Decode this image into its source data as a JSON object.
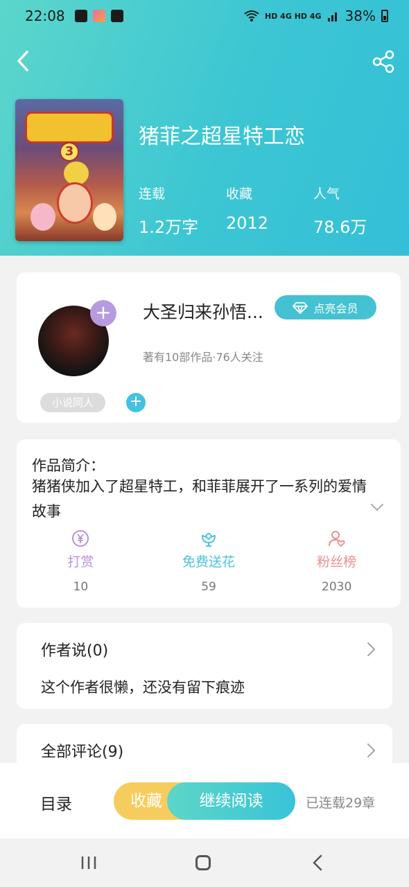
{
  "status_bar": {
    "time": "22:08",
    "network": "HD 4G HD 4G",
    "battery": "38%",
    "icons": [
      "image-icon",
      "app-icon",
      "notification-icon",
      "wifi-icon",
      "signal-icon",
      "battery-icon"
    ]
  },
  "header": {
    "back_icon": "chevron-left-icon",
    "share_icon": "share-icon",
    "cover_icon": "book-cover-image",
    "cover_number": "3",
    "title": "猪菲之超星特工恋",
    "stats": [
      {
        "label": "连载",
        "value": "1.2万字"
      },
      {
        "label": "收藏",
        "value": "2012"
      },
      {
        "label": "人气",
        "value": "78.6万"
      }
    ]
  },
  "author": {
    "name": "大圣归来孙悟...",
    "vip_label": "点亮会员",
    "meta": "著有10部作品·76人关注",
    "tag": "小说同人",
    "follow_icon": "plus-icon"
  },
  "intro": {
    "label": "作品简介：",
    "text": "猪猪侠加入了超星特工，和菲菲展开了一系列的爱情故事",
    "expand_icon": "chevron-down-icon"
  },
  "actions": [
    {
      "label": "打赏",
      "count": "10",
      "color": "#b98fde",
      "icon": "yuan-icon"
    },
    {
      "label": "免费送花",
      "count": "59",
      "color": "#4cc2dc",
      "icon": "flower-icon"
    },
    {
      "label": "粉丝榜",
      "count": "2030",
      "color": "#ee8d8d",
      "icon": "fan-icon"
    }
  ],
  "author_says": {
    "title": "作者说(0)",
    "text": "这个作者很懒，还没有留下痕迹"
  },
  "comments": {
    "title": "全部评论(9)"
  },
  "bottom_bar": {
    "toc": "目录",
    "favorite": "收藏",
    "continue_reading": "继续阅读",
    "chapters": "已连载29章"
  },
  "colors": {
    "header_start": "#5cd6cb",
    "header_end": "#34bfd8",
    "accent": "#44c2d3",
    "favorite": "#f7cc5e"
  }
}
